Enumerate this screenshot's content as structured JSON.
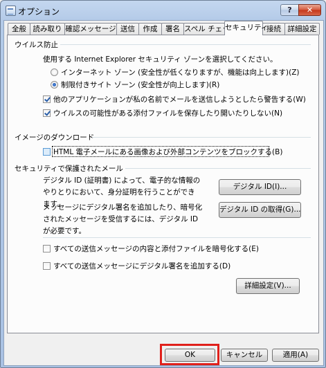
{
  "window": {
    "title": "オプション"
  },
  "caption_buttons": {
    "help": "?",
    "close": "✕"
  },
  "tabs": [
    {
      "label": "全般"
    },
    {
      "label": "読み取り"
    },
    {
      "label": "確認メッセージ"
    },
    {
      "label": "送信"
    },
    {
      "label": "作成"
    },
    {
      "label": "署名"
    },
    {
      "label": "スペル チェック"
    },
    {
      "label": "セキュリティ"
    },
    {
      "label": "接続"
    },
    {
      "label": "詳細設定"
    }
  ],
  "virus": {
    "title": "ウイルス防止",
    "zone_prompt": "使用する Internet Explorer セキュリティ ゾーンを選択してください。",
    "radio_internet": "インターネット ゾーン (安全性が低くなりますが、機能は向上します)(Z)",
    "radio_restricted": "制限付きサイト ゾーン (安全性が向上します)(R)",
    "check_warn": "他のアプリケーションが私の名前でメールを送信しようとしたら警告する(W)",
    "check_attach": "ウイルスの可能性がある添付ファイルを保存したり開いたりしない(N)"
  },
  "images": {
    "title": "イメージのダウンロード",
    "check_block": "HTML 電子メールにある画像および外部コンテンツをブロックする(B)"
  },
  "secure_mail": {
    "title": "セキュリティで保護されたメール",
    "digital_id_desc": "デジタル ID (証明書) によって、電子的な情報のやりとりにおいて、身分証明を行うことができます。",
    "digital_id_button": "デジタル ID(I)...",
    "get_id_desc": "メッセージにデジタル署名を追加したり、暗号化されたメッセージを受信するには、デジタル ID が必要です。",
    "get_id_button": "デジタル ID の取得(G)...",
    "check_encrypt": "すべての送信メッセージの内容と添付ファイルを暗号化する(E)",
    "check_sign": "すべての送信メッセージにデジタル署名を追加する(D)",
    "advanced_button": "詳細設定(V)..."
  },
  "footer": {
    "ok": "OK",
    "cancel": "キャンセル",
    "apply": "適用(A)"
  },
  "colors": {
    "highlight": "#e0201b",
    "accent": "#2a5ea8"
  }
}
